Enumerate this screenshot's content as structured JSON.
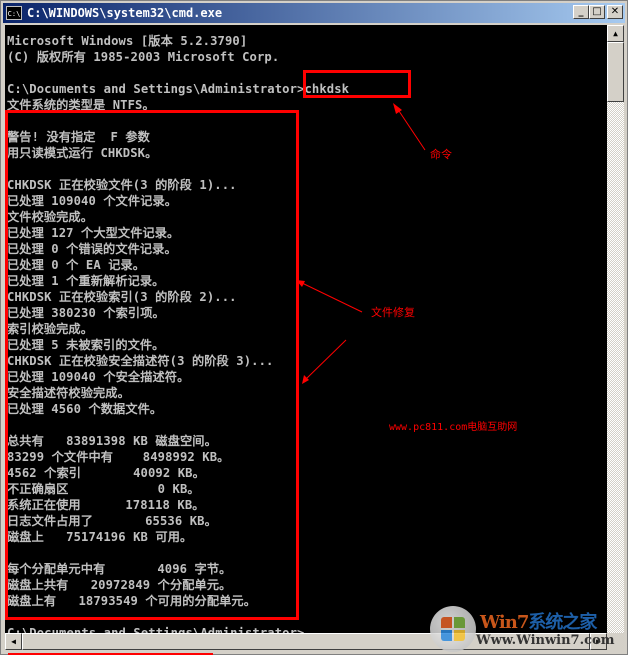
{
  "window": {
    "title": "C:\\WINDOWS\\system32\\cmd.exe",
    "icon": "console-app-icon",
    "icon_text": "C:\\",
    "controls": {
      "minimize": "_",
      "maximize": "□",
      "close": "✕"
    }
  },
  "console": {
    "text_color": "#c0c0c0",
    "background": "#000000",
    "lines": [
      "Microsoft Windows [版本 5.2.3790]",
      "(C) 版权所有 1985-2003 Microsoft Corp.",
      "",
      "C:\\Documents and Settings\\Administrator>chkdsk",
      "文件系统的类型是 NTFS。",
      "",
      "警告! 没有指定  F 参数",
      "用只读模式运行 CHKDSK。",
      "",
      "CHKDSK 正在校验文件(3 的阶段 1)...",
      "已处理 109040 个文件记录。",
      "文件校验完成。",
      "已处理 127 个大型文件记录。",
      "已处理 0 个错误的文件记录。",
      "已处理 0 个 EA 记录。",
      "已处理 1 个重新解析记录。",
      "CHKDSK 正在校验索引(3 的阶段 2)...",
      "已处理 380230 个索引项。",
      "索引校验完成。",
      "已处理 5 未被索引的文件。",
      "CHKDSK 正在校验安全描述符(3 的阶段 3)...",
      "已处理 109040 个安全描述符。",
      "安全描述符校验完成。",
      "已处理 4560 个数据文件。",
      "",
      "总共有   83891398 KB 磁盘空间。",
      "83299 个文件中有    8498992 KB。",
      "4562 个索引       40092 KB。",
      "不正确扇区            0 KB。",
      "系统正在使用      178118 KB。",
      "日志文件占用了       65536 KB。",
      "磁盘上   75174196 KB 可用。",
      "",
      "每个分配单元中有       4096 字节。",
      "磁盘上共有   20972849 个分配单元。",
      "磁盘上有   18793549 个可用的分配单元。",
      "",
      "C:\\Documents and Settings\\Administrator>"
    ]
  },
  "annotations": {
    "color": "#ff0000",
    "command_label": "命令",
    "repair_label": "文件修复",
    "site_credit": "www.pc811.com电脑互助网"
  },
  "scrollbars": {
    "up_arrow": "▲",
    "left_arrow": "◀",
    "right_arrow": "▶"
  },
  "watermark": {
    "brand_part1": "Win7",
    "brand_part2": "系统之家",
    "url": "Www.Winwin7.com"
  }
}
